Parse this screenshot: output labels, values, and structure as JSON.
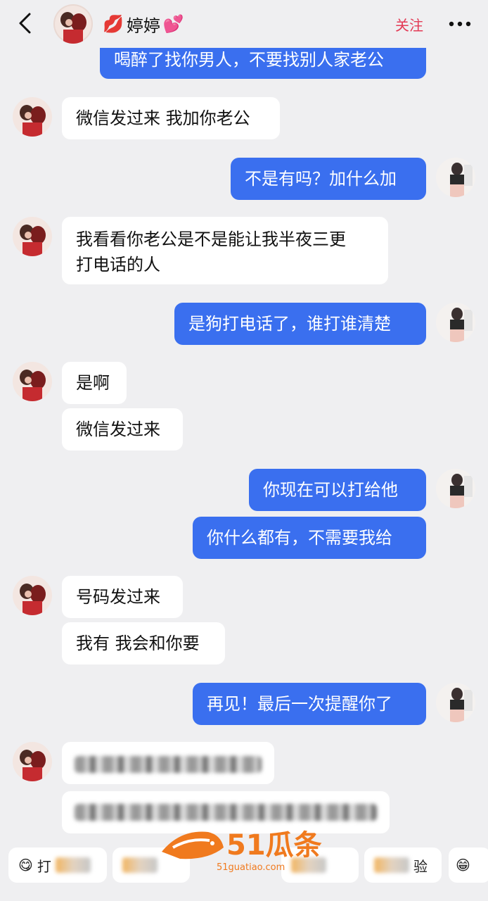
{
  "header": {
    "back_icon": "chevron-left-icon",
    "contact_name": "婷婷",
    "name_prefix_icon": "💋",
    "name_suffix_icon": "💕",
    "follow_label": "关注",
    "more_icon": "more-dots-icon"
  },
  "messages": [
    {
      "side": "right",
      "text": "喝醉了找你男人，不要找别人家老公"
    },
    {
      "side": "left",
      "text": "微信发过来 我加你老公"
    },
    {
      "side": "right",
      "text": "不是有吗？加什么加"
    },
    {
      "side": "left",
      "text": "我看看你老公是不是能让我半夜三更打电话的人",
      "line1": "我看看你老公是不是能让我半夜三更",
      "line2": "打电话的人"
    },
    {
      "side": "right",
      "text": "是狗打电话了，谁打谁清楚"
    },
    {
      "side": "left",
      "text": "是啊"
    },
    {
      "side": "left",
      "text": "微信发过来"
    },
    {
      "side": "right",
      "text": "你现在可以打给他"
    },
    {
      "side": "right",
      "text": "你什么都有，不需要我给"
    },
    {
      "side": "left",
      "text": "号码发过来"
    },
    {
      "side": "left",
      "text": "我有 我会和你要"
    },
    {
      "side": "right",
      "text": "再见！最后一次提醒你了"
    }
  ],
  "quick_replies": {
    "first_label": "打",
    "first_icon": "😋",
    "last_icon": "😁",
    "partial_label": "验"
  },
  "watermark": {
    "brand_text": "51瓜条",
    "url_text": "51guatiao.com"
  },
  "colors": {
    "background": "#efeff1",
    "right_bubble": "#3a6fef",
    "left_bubble": "#ffffff",
    "follow": "#e33a55",
    "watermark": "#f07a1e"
  }
}
